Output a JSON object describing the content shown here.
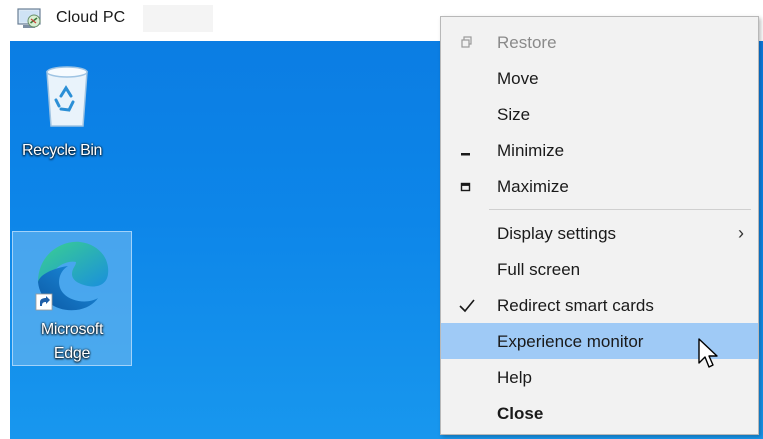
{
  "window": {
    "title": "Cloud PC"
  },
  "desktop": {
    "icons": [
      {
        "label": "Recycle Bin"
      },
      {
        "label_line1": "Microsoft",
        "label_line2": "Edge"
      }
    ]
  },
  "context_menu": {
    "items": [
      {
        "label": "Restore",
        "icon": "restore-icon",
        "disabled": true
      },
      {
        "label": "Move"
      },
      {
        "label": "Size"
      },
      {
        "label": "Minimize",
        "icon": "minimize-icon"
      },
      {
        "label": "Maximize",
        "icon": "maximize-icon"
      },
      {
        "label": "Display settings",
        "submenu_icon": "chevron-right-icon",
        "submenu_glyph": "›"
      },
      {
        "label": "Full screen"
      },
      {
        "label": "Redirect smart cards",
        "checked": true,
        "icon": "checkmark-icon"
      },
      {
        "label": "Experience monitor",
        "highlighted": true
      },
      {
        "label": "Help"
      },
      {
        "label": "Close",
        "bold": true
      }
    ]
  },
  "colors": {
    "desktop_bg": "#0b7de3",
    "menu_bg": "#f2f2f2",
    "menu_highlight": "#9fcaf6"
  }
}
